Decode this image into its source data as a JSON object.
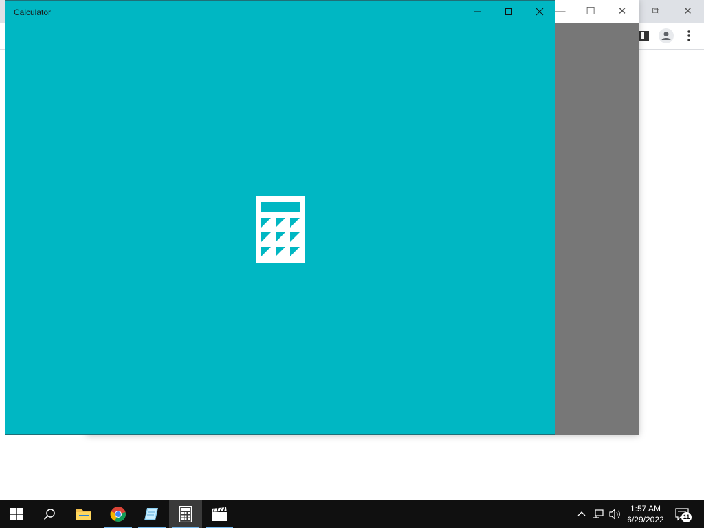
{
  "calculator": {
    "title": "Calculator",
    "minimize": "—",
    "maximize": "☐",
    "close": "✕",
    "accent_color": "#00b7c3"
  },
  "background_window": {
    "minimize": "—",
    "maximize": "☐",
    "close": "✕"
  },
  "browser": {
    "restore": "⧉",
    "close": "✕"
  },
  "taskbar": {
    "items": [
      {
        "name": "start",
        "icon": "windows-logo-icon"
      },
      {
        "name": "search",
        "icon": "search-icon"
      },
      {
        "name": "file-explorer",
        "icon": "folder-icon"
      },
      {
        "name": "chrome",
        "icon": "chrome-icon"
      },
      {
        "name": "notepad",
        "icon": "notepad-icon"
      },
      {
        "name": "calculator",
        "icon": "calculator-icon",
        "active": true
      },
      {
        "name": "movies-tv",
        "icon": "clapperboard-icon"
      }
    ],
    "clock": {
      "time": "1:57 AM",
      "date": "6/29/2022"
    },
    "notification_count": "11"
  }
}
